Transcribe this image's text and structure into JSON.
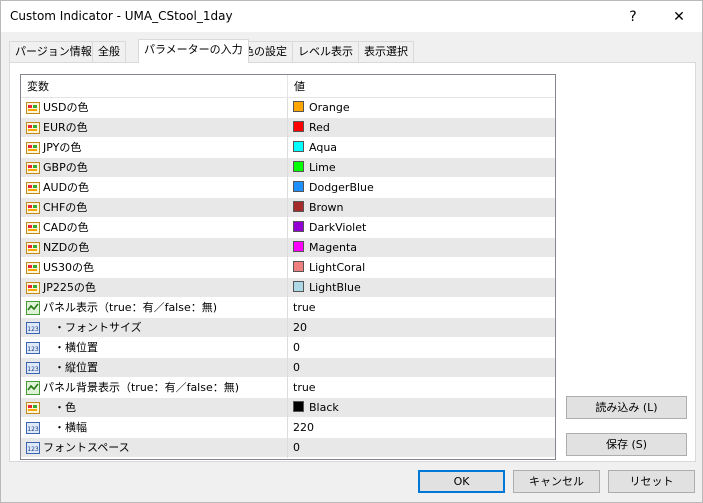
{
  "window": {
    "title": "Custom Indicator - UMA_CStool_1day",
    "help_label": "?",
    "close_label": "✕"
  },
  "tabs": [
    {
      "label": "パージョン情報"
    },
    {
      "label": "全般"
    },
    {
      "label": "パラメーターの入力"
    },
    {
      "label": "色の設定"
    },
    {
      "label": "レベル表示"
    },
    {
      "label": "表示選択"
    }
  ],
  "grid": {
    "header_name": "変数",
    "header_value": "値",
    "rows": [
      {
        "name": "USDの色",
        "value": "Orange",
        "icon": "color-param-icon",
        "swatch": "#ffa500"
      },
      {
        "name": "EURの色",
        "value": "Red",
        "icon": "color-param-icon",
        "swatch": "#ff0000"
      },
      {
        "name": "JPYの色",
        "value": "Aqua",
        "icon": "color-param-icon",
        "swatch": "#00ffff"
      },
      {
        "name": "GBPの色",
        "value": "Lime",
        "icon": "color-param-icon",
        "swatch": "#00ff00"
      },
      {
        "name": "AUDの色",
        "value": "DodgerBlue",
        "icon": "color-param-icon",
        "swatch": "#1e90ff"
      },
      {
        "name": "CHFの色",
        "value": "Brown",
        "icon": "color-param-icon",
        "swatch": "#a52a2a"
      },
      {
        "name": "CADの色",
        "value": "DarkViolet",
        "icon": "color-param-icon",
        "swatch": "#9400d3"
      },
      {
        "name": "NZDの色",
        "value": "Magenta",
        "icon": "color-param-icon",
        "swatch": "#ff00ff"
      },
      {
        "name": "US30の色",
        "value": "LightCoral",
        "icon": "color-param-icon",
        "swatch": "#f08080"
      },
      {
        "name": "JP225の色",
        "value": "LightBlue",
        "icon": "color-param-icon",
        "swatch": "#add8e6"
      },
      {
        "name": "パネル表示（true：有／false：無)",
        "value": "true",
        "icon": "bool-param-icon"
      },
      {
        "name": "　・フォントサイズ",
        "value": "20",
        "icon": "int-param-icon"
      },
      {
        "name": "　・横位置",
        "value": "0",
        "icon": "int-param-icon"
      },
      {
        "name": "　・縦位置",
        "value": "0",
        "icon": "int-param-icon"
      },
      {
        "name": "パネル背景表示（true：有／false：無)",
        "value": "true",
        "icon": "bool-param-icon"
      },
      {
        "name": "　・色",
        "value": "Black",
        "icon": "color-param-icon",
        "swatch": "#000000"
      },
      {
        "name": "　・横幅",
        "value": "220",
        "icon": "int-param-icon"
      },
      {
        "name": "フォントスペース",
        "value": "0",
        "icon": "int-param-icon"
      }
    ]
  },
  "side_buttons": {
    "load": "読み込み (L)",
    "save": "保存 (S)"
  },
  "footer": {
    "ok": "OK",
    "cancel": "キャンセル",
    "reset": "リセット"
  }
}
